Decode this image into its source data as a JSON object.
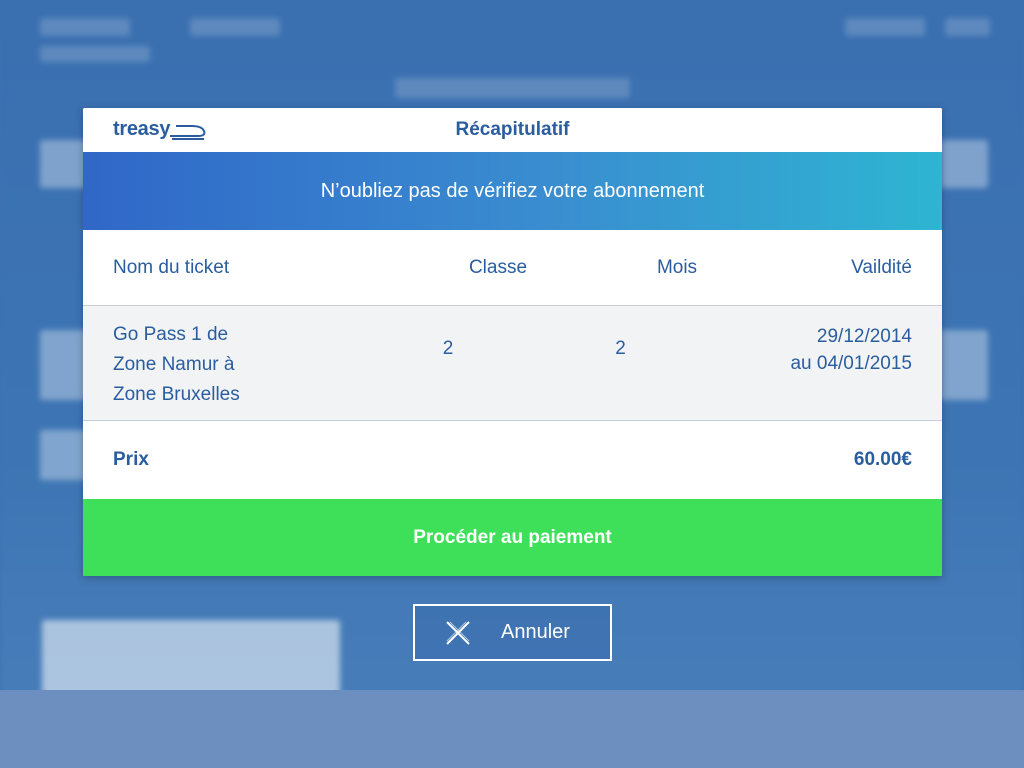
{
  "modal": {
    "logo_text": "treasy",
    "title": "Récapitulatif",
    "banner_text": "N’oubliez pas de vérifiez votre abonnement",
    "table": {
      "headers": [
        "Nom du ticket",
        "Classe",
        "Mois",
        "Vaildité"
      ],
      "row": {
        "name_lines": [
          "Go Pass 1 de",
          "Zone Namur à",
          "Zone Bruxelles"
        ],
        "classe": "2",
        "mois": "2",
        "validity_lines": [
          "29/12/2014",
          "au 04/01/2015"
        ]
      }
    },
    "price_label": "Prix",
    "price_value": "60.00€",
    "pay_button": "Procéder au paiement"
  },
  "cancel_button": {
    "label": "Annuler",
    "icon": "close-icon"
  },
  "colors": {
    "primary_text": "#2a5d9f",
    "pay_green": "#3ee05a",
    "banner_start": "#3067c8",
    "banner_end": "#2eb5d2"
  }
}
